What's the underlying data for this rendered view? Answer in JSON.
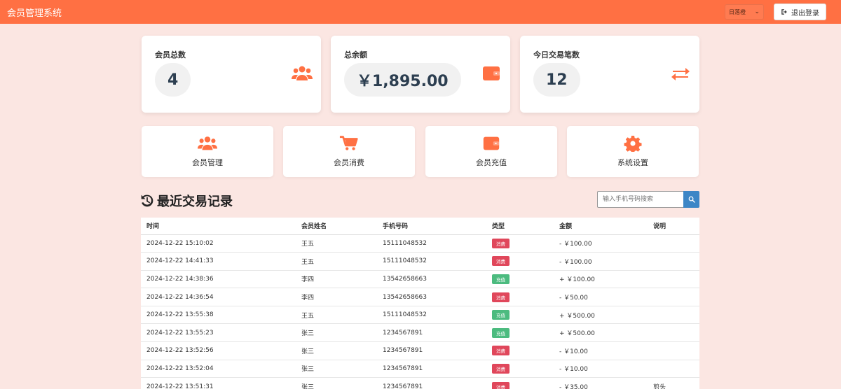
{
  "header": {
    "title": "会员管理系统",
    "theme_label": "日落橙",
    "logout_label": "退出登录"
  },
  "stats": [
    {
      "label": "会员总数",
      "value": "4",
      "icon": "users-icon"
    },
    {
      "label": "总余额",
      "value": "￥1,895.00",
      "icon": "wallet-icon"
    },
    {
      "label": "今日交易笔数",
      "value": "12",
      "icon": "exchange-icon"
    }
  ],
  "nav": [
    {
      "label": "会员管理",
      "icon": "users-icon"
    },
    {
      "label": "会员消费",
      "icon": "cart-icon"
    },
    {
      "label": "会员充值",
      "icon": "wallet-icon"
    },
    {
      "label": "系统设置",
      "icon": "gear-icon"
    }
  ],
  "transactions": {
    "title": "最近交易记录",
    "search_placeholder": "输入手机号码搜索",
    "columns": [
      "时间",
      "会员姓名",
      "手机号码",
      "类型",
      "金额",
      "说明"
    ],
    "rows": [
      {
        "time": "2024-12-22 15:10:02",
        "name": "王五",
        "phone": "15111048532",
        "type": "消费",
        "kind": "consume",
        "amount": "- ￥100.00",
        "note": ""
      },
      {
        "time": "2024-12-22 14:41:33",
        "name": "王五",
        "phone": "15111048532",
        "type": "消费",
        "kind": "consume",
        "amount": "- ￥100.00",
        "note": ""
      },
      {
        "time": "2024-12-22 14:38:36",
        "name": "李四",
        "phone": "13542658663",
        "type": "充值",
        "kind": "recharge",
        "amount": "+ ￥100.00",
        "note": ""
      },
      {
        "time": "2024-12-22 14:36:54",
        "name": "李四",
        "phone": "13542658663",
        "type": "消费",
        "kind": "consume",
        "amount": "- ￥50.00",
        "note": ""
      },
      {
        "time": "2024-12-22 13:55:38",
        "name": "王五",
        "phone": "15111048532",
        "type": "充值",
        "kind": "recharge",
        "amount": "+ ￥500.00",
        "note": ""
      },
      {
        "time": "2024-12-22 13:55:23",
        "name": "张三",
        "phone": "1234567891",
        "type": "充值",
        "kind": "recharge",
        "amount": "+ ￥500.00",
        "note": ""
      },
      {
        "time": "2024-12-22 13:52:56",
        "name": "张三",
        "phone": "1234567891",
        "type": "消费",
        "kind": "consume",
        "amount": "- ￥10.00",
        "note": ""
      },
      {
        "time": "2024-12-22 13:52:04",
        "name": "张三",
        "phone": "1234567891",
        "type": "消费",
        "kind": "consume",
        "amount": "- ￥10.00",
        "note": ""
      },
      {
        "time": "2024-12-22 13:51:31",
        "name": "张三",
        "phone": "1234567891",
        "type": "消费",
        "kind": "consume",
        "amount": "- ￥35.00",
        "note": "剪头"
      }
    ]
  },
  "colors": {
    "accent": "#ff7043",
    "background": "#fbe6e2",
    "consume": "#e0475b",
    "recharge": "#4cbb7f",
    "search_button": "#3d86c6"
  }
}
